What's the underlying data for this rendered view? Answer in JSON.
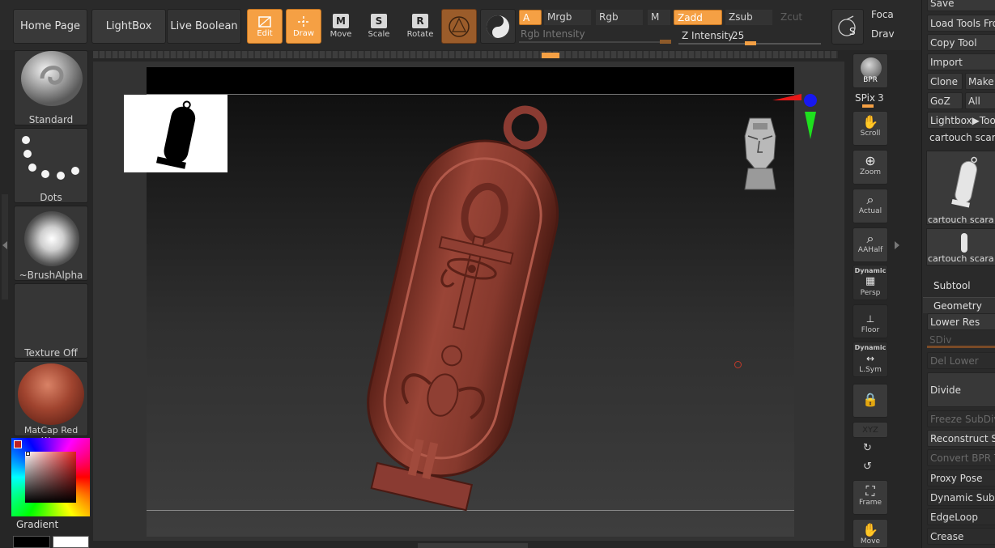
{
  "toolbar": {
    "home_page": "Home Page",
    "lightbox": "LightBox",
    "live_boolean": "Live Boolean",
    "edit": "Edit",
    "draw": "Draw",
    "move": "Move",
    "scale": "Scale",
    "rotate": "Rotate",
    "move_key": "M",
    "scale_key": "S",
    "rotate_key": "R",
    "a": "A",
    "mrgb": "Mrgb",
    "rgb": "Rgb",
    "m": "M",
    "zadd": "Zadd",
    "zsub": "Zsub",
    "zcut": "Zcut",
    "rgb_intensity": "Rgb Intensity",
    "z_intensity_label": "Z Intensity",
    "z_intensity_value": "25",
    "focal": "Foca",
    "draw_size": "Drav",
    "s_label": "S"
  },
  "left_panel": {
    "standard": "Standard",
    "dots": "Dots",
    "brush_alpha": "~BrushAlpha",
    "texture_off": "Texture Off",
    "matcap": "MatCap Red Wax",
    "gradient": "Gradient"
  },
  "right_shelf": {
    "bpr": "BPR",
    "spix_label": "SPix",
    "spix_value": "3",
    "scroll": "Scroll",
    "zoom": "Zoom",
    "actual": "Actual",
    "aahalf": "AAHalf",
    "dynamic": "Dynamic",
    "persp": "Persp",
    "floor": "Floor",
    "dynamic2": "Dynamic",
    "lsym": "L.Sym",
    "xyz": "XYZ",
    "frame": "Frame",
    "move": "Move"
  },
  "right_panel": {
    "save": "Save",
    "load_tools": "Load Tools From",
    "copy_tool": "Copy Tool",
    "import": "Import",
    "clone": "Clone",
    "make": "Make",
    "goz": "GoZ",
    "all": "All",
    "lightbox_tools": "Lightbox▶Tools",
    "tool_name": "cartouch scara",
    "thumb1_label": "cartouch scara",
    "thumb2_label": "cartouch scara",
    "subtool": "Subtool",
    "geometry": "Geometry",
    "lower_res": "Lower Res",
    "sdiv": "SDiv",
    "del_lower": "Del Lower",
    "divide": "Divide",
    "freeze_subdiv": "Freeze SubDiv",
    "reconstruct": "Reconstruct Su",
    "convert_bpr": "Convert BPR To",
    "proxy_pose": "Proxy Pose",
    "dynamic_subdiv": "Dynamic Subdi",
    "edgeloop": "EdgeLoop",
    "crease": "Crease"
  },
  "colors": {
    "accent": "#f5a044",
    "model": "#8a3b32",
    "panel": "#383838"
  }
}
